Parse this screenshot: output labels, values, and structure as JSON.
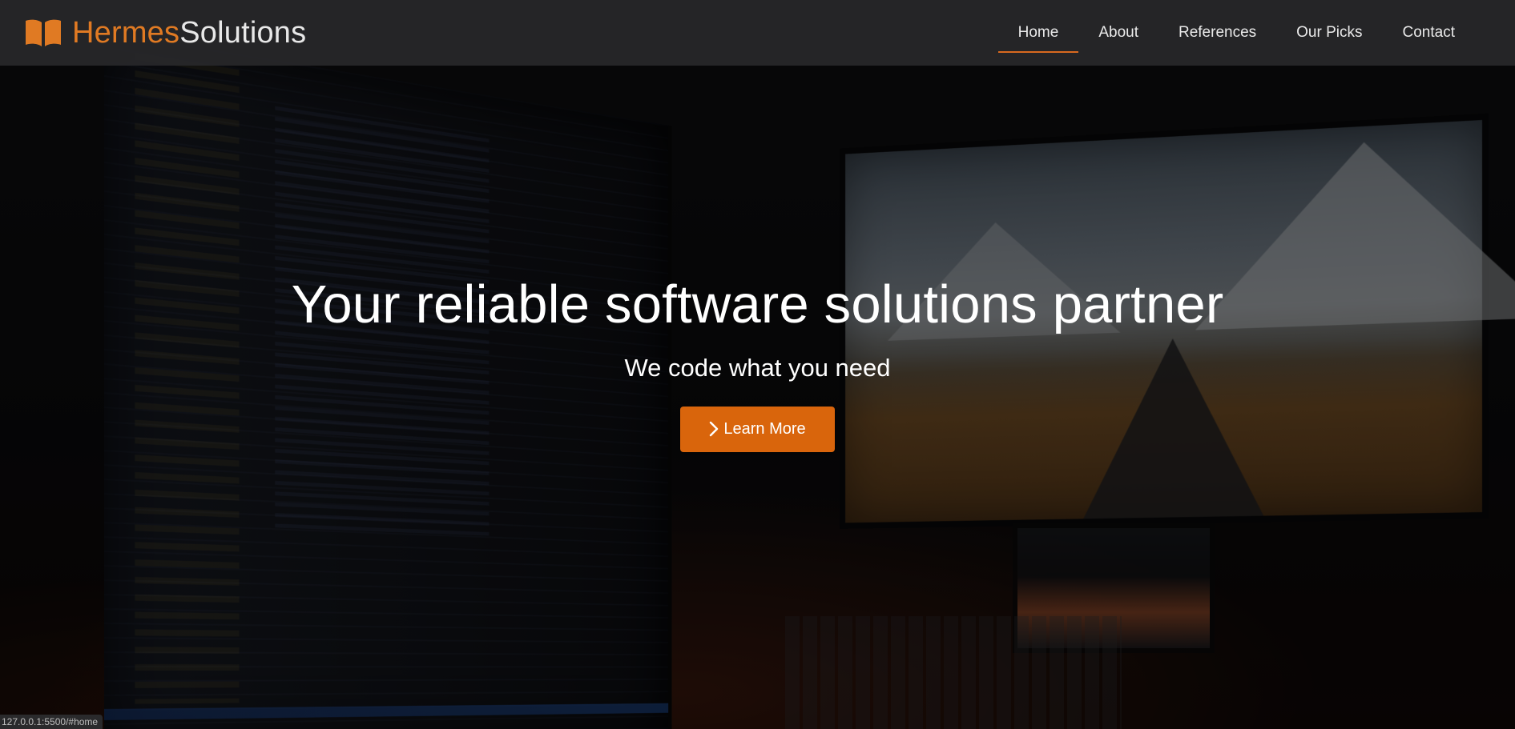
{
  "brand": {
    "part1": "Hermes",
    "part2": "Solutions",
    "icon": "open-book-icon",
    "accent_color": "#e07a23"
  },
  "nav": {
    "items": [
      {
        "label": "Home",
        "active": true
      },
      {
        "label": "About",
        "active": false
      },
      {
        "label": "References",
        "active": false
      },
      {
        "label": "Our Picks",
        "active": false
      },
      {
        "label": "Contact",
        "active": false
      }
    ],
    "active_underline_color": "#d9691f"
  },
  "hero": {
    "title": "Your reliable software solutions partner",
    "subtitle": "We code what you need",
    "cta_label": "Learn More",
    "cta_icon": "chevron-right-icon",
    "cta_color": "#d9650c"
  },
  "status_bar": {
    "url": "127.0.0.1:5500/#home"
  }
}
